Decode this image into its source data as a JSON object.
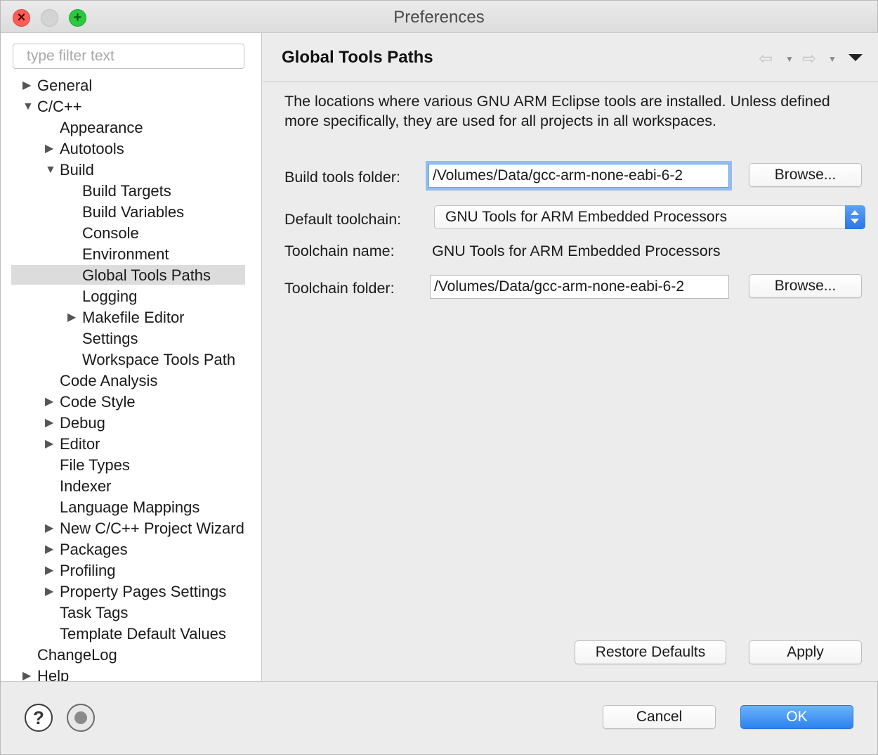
{
  "window": {
    "title": "Preferences"
  },
  "filter": {
    "placeholder": "type filter text",
    "value": ""
  },
  "tree": [
    {
      "label": "General",
      "expandable": true,
      "expanded": false,
      "level": 0
    },
    {
      "label": "C/C++",
      "expandable": true,
      "expanded": true,
      "level": 0
    },
    {
      "label": "Appearance",
      "expandable": false,
      "level": 1
    },
    {
      "label": "Autotools",
      "expandable": true,
      "expanded": false,
      "level": 1
    },
    {
      "label": "Build",
      "expandable": true,
      "expanded": true,
      "level": 1
    },
    {
      "label": "Build Targets",
      "expandable": false,
      "level": 2
    },
    {
      "label": "Build Variables",
      "expandable": false,
      "level": 2
    },
    {
      "label": "Console",
      "expandable": false,
      "level": 2
    },
    {
      "label": "Environment",
      "expandable": false,
      "level": 2
    },
    {
      "label": "Global Tools Paths",
      "expandable": false,
      "level": 2,
      "selected": true
    },
    {
      "label": "Logging",
      "expandable": false,
      "level": 2
    },
    {
      "label": "Makefile Editor",
      "expandable": true,
      "expanded": false,
      "level": 2
    },
    {
      "label": "Settings",
      "expandable": false,
      "level": 2
    },
    {
      "label": "Workspace Tools Path",
      "expandable": false,
      "level": 2
    },
    {
      "label": "Code Analysis",
      "expandable": false,
      "level": 1
    },
    {
      "label": "Code Style",
      "expandable": true,
      "expanded": false,
      "level": 1
    },
    {
      "label": "Debug",
      "expandable": true,
      "expanded": false,
      "level": 1
    },
    {
      "label": "Editor",
      "expandable": true,
      "expanded": false,
      "level": 1
    },
    {
      "label": "File Types",
      "expandable": false,
      "level": 1
    },
    {
      "label": "Indexer",
      "expandable": false,
      "level": 1
    },
    {
      "label": "Language Mappings",
      "expandable": false,
      "level": 1
    },
    {
      "label": "New C/C++ Project Wizard",
      "expandable": true,
      "expanded": false,
      "level": 1
    },
    {
      "label": "Packages",
      "expandable": true,
      "expanded": false,
      "level": 1
    },
    {
      "label": "Profiling",
      "expandable": true,
      "expanded": false,
      "level": 1
    },
    {
      "label": "Property Pages Settings",
      "expandable": true,
      "expanded": false,
      "level": 1
    },
    {
      "label": "Task Tags",
      "expandable": false,
      "level": 1
    },
    {
      "label": "Template Default Values",
      "expandable": false,
      "level": 1
    },
    {
      "label": "ChangeLog",
      "expandable": false,
      "level": 0
    },
    {
      "label": "Help",
      "expandable": true,
      "expanded": false,
      "level": 0
    }
  ],
  "page": {
    "title": "Global Tools Paths",
    "description": "The locations where various GNU ARM Eclipse tools are installed. Unless defined more specifically, they are used for all projects in all workspaces.",
    "build_tools_label": "Build tools folder:",
    "build_tools_value": "/Volumes/Data/gcc-arm-none-eabi-6-2",
    "browse_label": "Browse...",
    "default_toolchain_label": "Default toolchain:",
    "default_toolchain_value": "GNU Tools for ARM Embedded Processors",
    "toolchain_name_label": "Toolchain name:",
    "toolchain_name_value": "GNU Tools for ARM Embedded Processors",
    "toolchain_folder_label": "Toolchain folder:",
    "toolchain_folder_value": "/Volumes/Data/gcc-arm-none-eabi-6-2",
    "restore_defaults_label": "Restore Defaults",
    "apply_label": "Apply"
  },
  "nav": {
    "back_icon": "back-arrow-icon",
    "forward_icon": "forward-arrow-icon",
    "menu_icon": "view-menu-icon"
  },
  "footer": {
    "cancel_label": "Cancel",
    "ok_label": "OK",
    "help_icon": "help-icon",
    "record_icon": "record-macro-icon"
  },
  "colors": {
    "accent": "#2c82ee",
    "selection": "#dcdcdc",
    "focus_ring": "#93bdf0"
  }
}
